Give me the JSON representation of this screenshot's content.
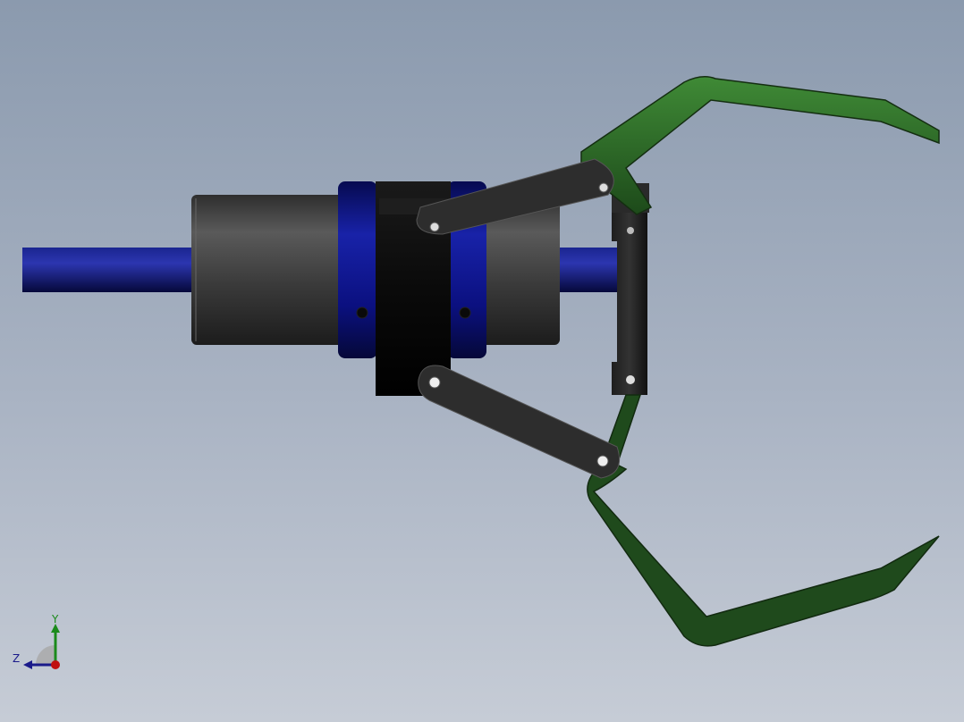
{
  "viewport": {
    "background_top": "#8b9aae",
    "background_bottom": "#c6ccd6"
  },
  "model": {
    "shaft_color": "#0d1470",
    "housing_color": "#3a3a3a",
    "collar_color": "#0a0f78",
    "block_color": "#060606",
    "link_color": "#2c2c2c",
    "jaw_color": "#1f4a1c",
    "jaw_highlight": "#3f8a36"
  },
  "triad": {
    "y_label": "Y",
    "z_label": "Z",
    "y_color": "#1b8a1b",
    "z_color": "#1a1a8a",
    "x_color": "#c01010"
  }
}
